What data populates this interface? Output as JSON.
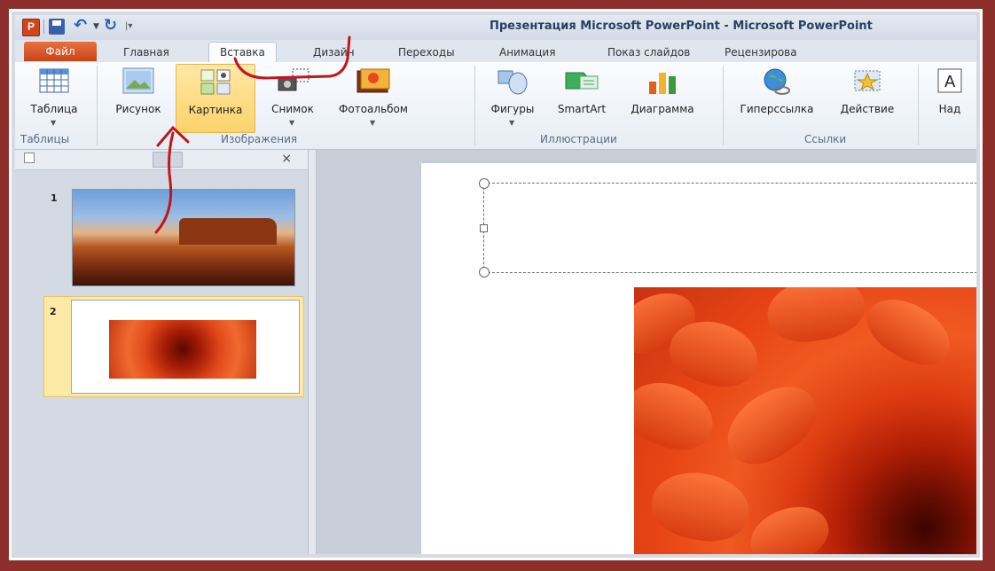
{
  "window": {
    "title": "Презентация Microsoft PowerPoint - Microsoft PowerPoint",
    "app_logo": "P"
  },
  "tabs": {
    "file": "Файл",
    "items": [
      "Главная",
      "Вставка",
      "Дизайн",
      "Переходы",
      "Анимация",
      "Показ слайдов",
      "Рецензирова"
    ],
    "active": "Вставка"
  },
  "ribbon": {
    "groups": [
      {
        "label": "Таблицы",
        "buttons": [
          {
            "label": "Таблица",
            "icon": "table-icon"
          }
        ]
      },
      {
        "label": "Изображения",
        "buttons": [
          {
            "label": "Рисунок",
            "icon": "picture-icon"
          },
          {
            "label": "Картинка",
            "icon": "clipart-icon",
            "selected": true
          },
          {
            "label": "Снимок",
            "icon": "screenshot-icon"
          },
          {
            "label": "Фотоальбом",
            "icon": "photo-album-icon"
          }
        ]
      },
      {
        "label": "Иллюстрации",
        "buttons": [
          {
            "label": "Фигуры",
            "icon": "shapes-icon"
          },
          {
            "label": "SmartArt",
            "icon": "smartart-icon"
          },
          {
            "label": "Диаграмма",
            "icon": "chart-icon"
          }
        ]
      },
      {
        "label": "Ссылки",
        "buttons": [
          {
            "label": "Гиперссылка",
            "icon": "hyperlink-icon"
          },
          {
            "label": "Действие",
            "icon": "action-icon"
          }
        ]
      },
      {
        "label": "",
        "buttons": [
          {
            "label": "Над",
            "icon": "textbox-icon"
          }
        ]
      }
    ]
  },
  "slides_pane": {
    "close_glyph": "×",
    "slides": [
      {
        "number": "1",
        "content": "desert-landscape-image"
      },
      {
        "number": "2",
        "content": "orange-flower-image",
        "selected": true
      }
    ]
  },
  "colors": {
    "frame": "#8c2f2b",
    "file_tab": "#d8552a",
    "selected_button": "#fcd36b",
    "annotation": "#c0161c"
  }
}
